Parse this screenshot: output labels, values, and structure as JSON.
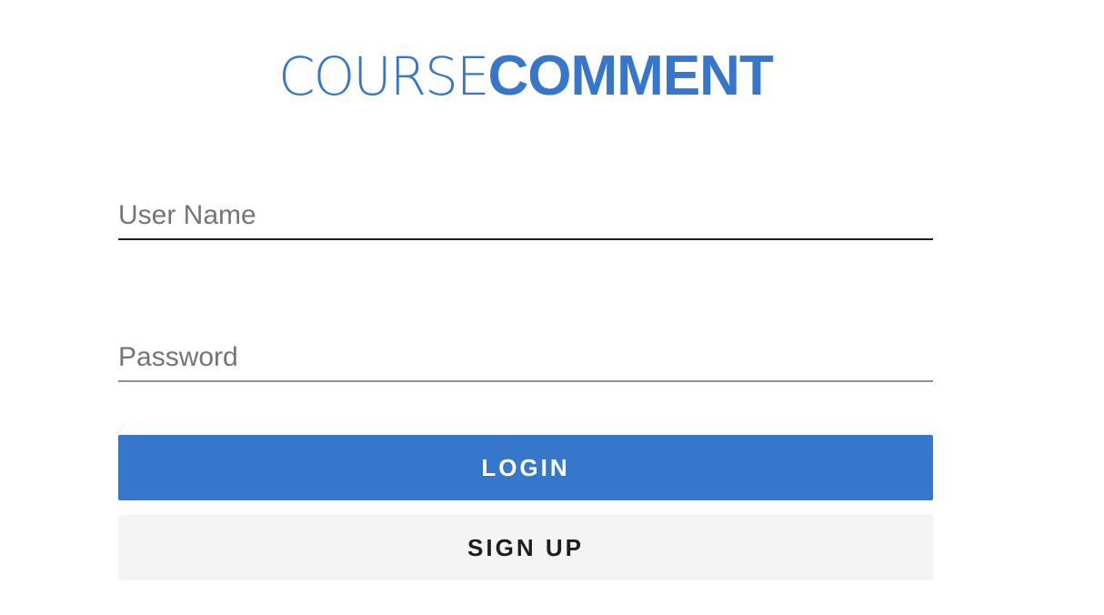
{
  "logo": {
    "light_text": "COURSE",
    "bold_text": "COMMENT"
  },
  "form": {
    "username_placeholder": "User Name",
    "username_value": "",
    "password_placeholder": "Password",
    "password_value": "",
    "login_label": "LOGIN",
    "signup_label": "SIGN UP"
  },
  "colors": {
    "brand": "#3677cb",
    "secondary_button_bg": "#f4f4f4",
    "text_dark": "#1d1d1d",
    "placeholder": "#757575"
  }
}
